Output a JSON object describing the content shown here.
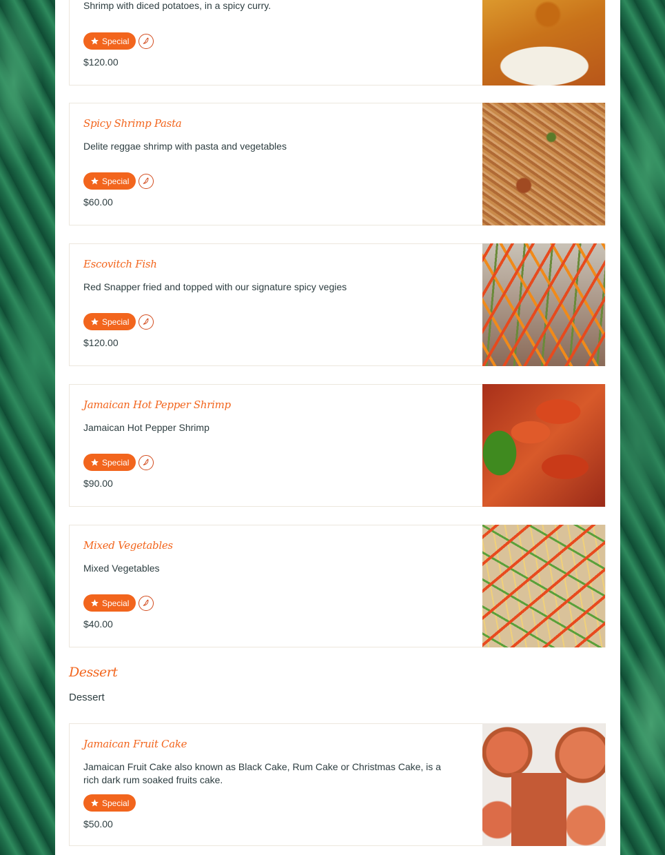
{
  "menu": {
    "items": [
      {
        "name": "",
        "description": "Shrimp with diced potatoes, in a spicy curry.",
        "badge": "Special",
        "spicy": true,
        "price": "$120.00",
        "photo": "curry-shrimp-photo"
      },
      {
        "name": "Spicy Shrimp Pasta",
        "description": "Delite reggae shrimp with pasta and vegetables",
        "badge": "Special",
        "spicy": true,
        "price": "$60.00",
        "photo": "shrimp-pasta-photo"
      },
      {
        "name": "Escovitch Fish",
        "description": "Red Snapper fried and topped with our signature spicy vegies",
        "badge": "Special",
        "spicy": true,
        "price": "$120.00",
        "photo": "escovitch-fish-photo"
      },
      {
        "name": "Jamaican Hot Pepper Shrimp",
        "description": "Jamaican Hot Pepper Shrimp",
        "badge": "Special",
        "spicy": true,
        "price": "$90.00",
        "photo": "hot-pepper-shrimp-photo"
      },
      {
        "name": "Mixed Vegetables",
        "description": "Mixed Vegetables",
        "badge": "Special",
        "spicy": true,
        "price": "$40.00",
        "photo": "mixed-vegetables-photo"
      }
    ]
  },
  "dessert": {
    "title": "Dessert",
    "description": "Dessert",
    "items": [
      {
        "name": "Jamaican Fruit Cake",
        "description": "Jamaican Fruit Cake also known as Black Cake, Rum Cake or Christmas Cake, is a rich dark rum soaked fruits cake.",
        "badge": "Special",
        "spicy": false,
        "price": "$50.00",
        "photo": "fruit-cake-photo"
      }
    ]
  },
  "colors": {
    "accent": "#f2651d",
    "text": "#2d3d40",
    "card_border": "#ece7dd",
    "background_leaves": "#155a3d"
  },
  "icons": {
    "badge_icon": "star-icon",
    "spicy_icon": "chili-pepper-icon"
  }
}
